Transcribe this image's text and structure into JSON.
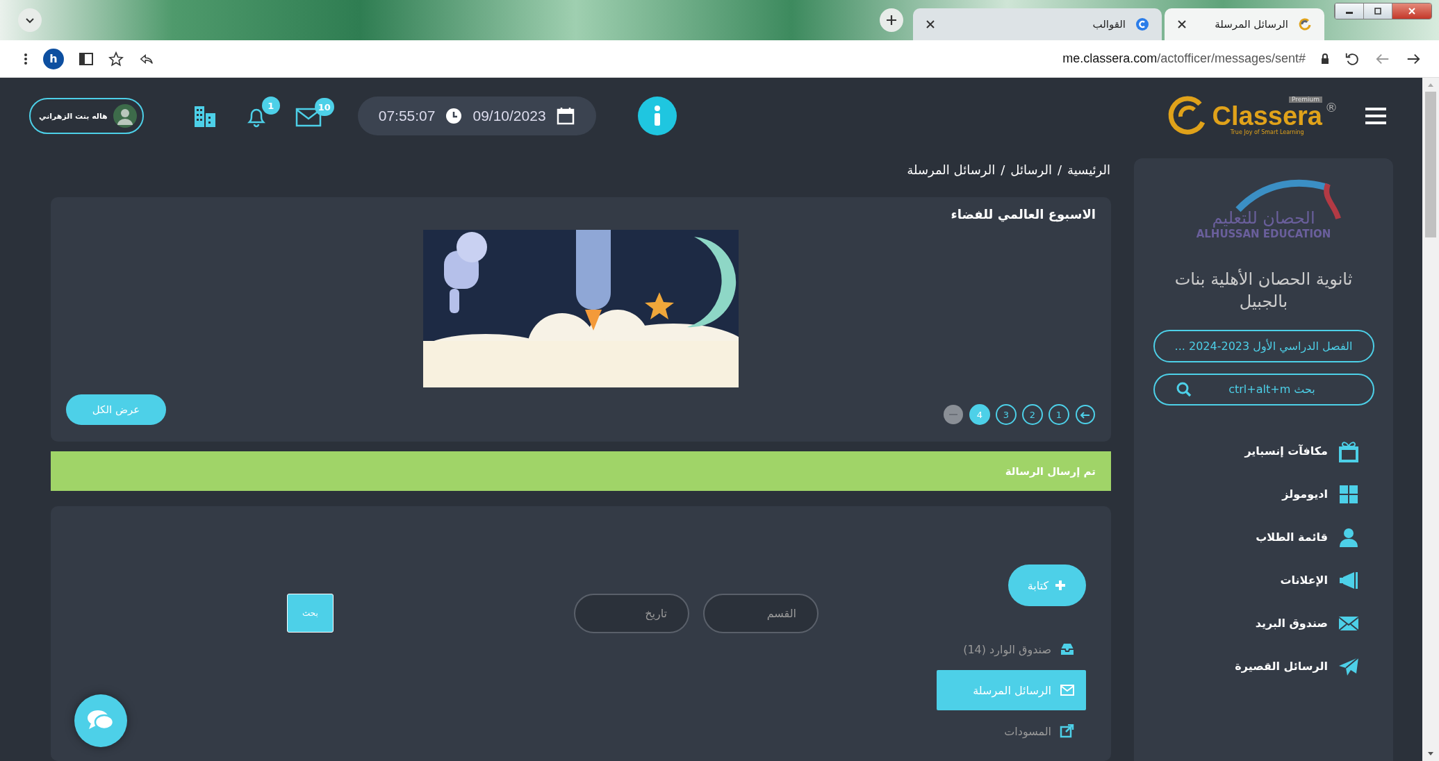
{
  "browser": {
    "tabs": [
      {
        "title": "الرسائل المرسلة",
        "selected": true
      },
      {
        "title": "القوالب",
        "selected": false
      }
    ],
    "profile_initial": "h",
    "url_host": "me.classera.com",
    "url_path": "/actofficer/messages/sent#"
  },
  "header": {
    "logo_text": "Classera",
    "logo_badge": "Premium",
    "logo_mark": "®",
    "logo_tagline": "True Joy of Smart Learning",
    "date": "09/10/2023",
    "time": "07:55:07",
    "messages_count": "10",
    "notifications_count": "1",
    "user_name": "هاله بنت الزهراني"
  },
  "sidebar": {
    "school_logo_arabic": "الحصان للتعليم",
    "school_logo_english": "ALHUSSAN EDUCATION",
    "school_name": "ثانوية الحصان الأهلية بنات بالجبيل",
    "term": "الفصل الدراسي الأول 2023-2024 ...",
    "search_placeholder": "بحث  ctrl+alt+m",
    "items": [
      {
        "label": "مكافآت إنسباير"
      },
      {
        "label": "اديومولز"
      },
      {
        "label": "قائمة الطلاب"
      },
      {
        "label": "الإعلانات"
      },
      {
        "label": "صندوق البريد"
      },
      {
        "label": "الرسائل القصيرة"
      }
    ]
  },
  "breadcrumb": {
    "separator": "/",
    "items": [
      "الرئيسية",
      "الرسائل",
      "الرسائل المرسلة"
    ]
  },
  "announcement": {
    "title": "الاسبوع العالمي للفضاء",
    "view_all": "عرض الكل",
    "pages": [
      {
        "label": "1",
        "selected": false
      },
      {
        "label": "2",
        "selected": false
      },
      {
        "label": "3",
        "selected": false
      },
      {
        "label": "4",
        "selected": true
      }
    ]
  },
  "alert": "تم إرسال الرسالة",
  "messages": {
    "compose": "كتابة",
    "filters": [
      {
        "placeholder": "القسم"
      },
      {
        "placeholder": "تاريخ"
      }
    ],
    "search_button": "بحث",
    "folders": [
      {
        "label": "صندوق الوارد (14)",
        "selected": false
      },
      {
        "label": "الرسائل المرسلة",
        "selected": true
      },
      {
        "label": "المسودات",
        "selected": false
      }
    ]
  }
}
